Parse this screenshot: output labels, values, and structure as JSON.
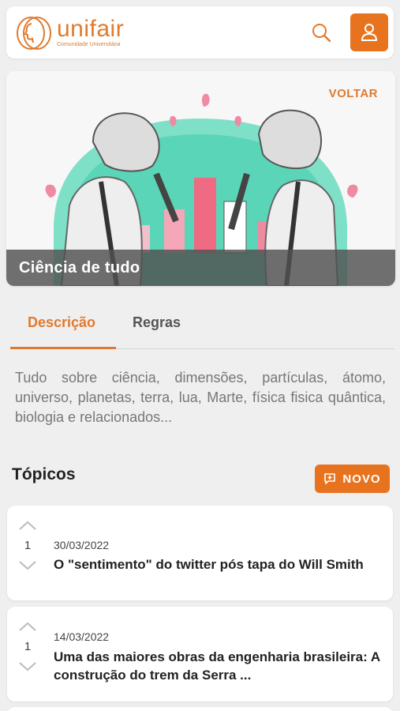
{
  "header": {
    "logo_name": "unifair",
    "logo_subtitle": "Comunidade Universitária",
    "icons": {
      "search": "search-icon",
      "user": "user-icon"
    },
    "accent_color": "#e8731f"
  },
  "banner": {
    "back_label": "VOLTAR",
    "caption": "Ciência de tudo"
  },
  "tabs": [
    {
      "label": "Descrição",
      "active": true
    },
    {
      "label": "Regras",
      "active": false
    }
  ],
  "description": "Tudo sobre ciência, dimensões, partículas, átomo, universo, planetas, terra, lua, Marte, física fisica quântica, biologia e relacionados...",
  "topics": {
    "title": "Tópicos",
    "new_button_label": "NOVO",
    "items": [
      {
        "votes": "1",
        "date": "30/03/2022",
        "title": "O \"sentimento\" do twitter pós tapa do Will Smith"
      },
      {
        "votes": "1",
        "date": "14/03/2022",
        "title": "Uma das maiores obras da engenharia brasileira: A construção do trem da Serra ..."
      }
    ]
  }
}
